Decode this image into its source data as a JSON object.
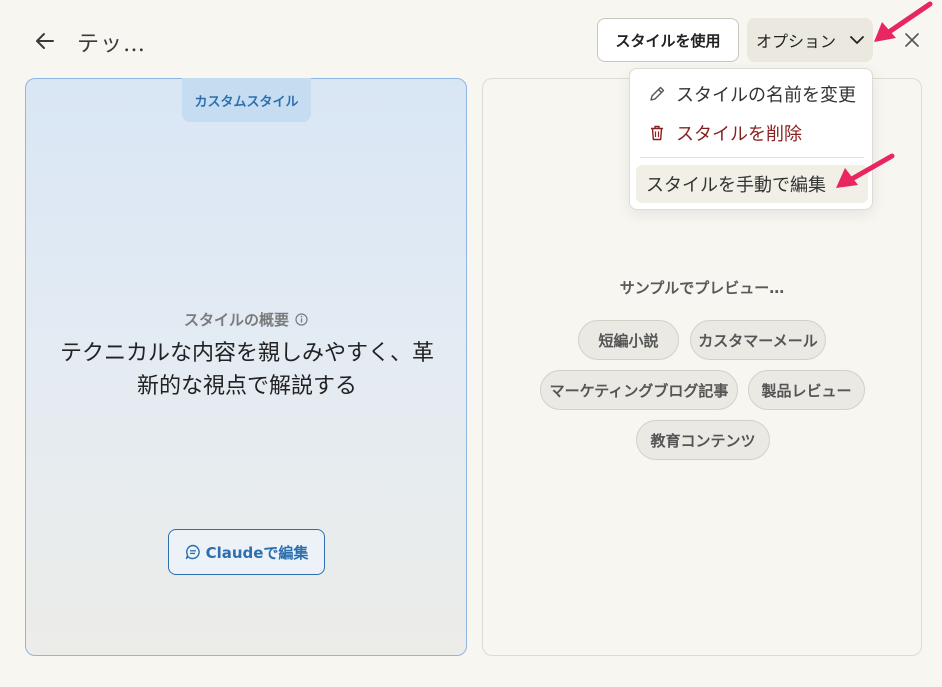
{
  "header": {
    "title": "テッ…",
    "use_style_label": "スタイルを使用",
    "options_label": "オプション"
  },
  "style_card": {
    "tag": "カスタムスタイル",
    "summary_label": "スタイルの概要",
    "summary_text": "テクニカルな内容を親しみやすく、革新的な視点で解説する",
    "edit_button_label": "Claudeで編集"
  },
  "preview": {
    "label": "サンプルでプレビュー…",
    "chips": [
      "短編小説",
      "カスタマーメール",
      "マーケティングブログ記事",
      "製品レビュー",
      "教育コンテンツ"
    ]
  },
  "options_menu": {
    "items": [
      {
        "label": "スタイルの名前を変更",
        "icon": "pencil-icon"
      },
      {
        "label": "スタイルを削除",
        "icon": "trash-icon"
      },
      {
        "label": "スタイルを手動で編集",
        "icon": ""
      }
    ]
  },
  "colors": {
    "accent_blue": "#2d6fae",
    "annotation_arrow": "#e8265f",
    "danger": "#8a1f1f"
  }
}
